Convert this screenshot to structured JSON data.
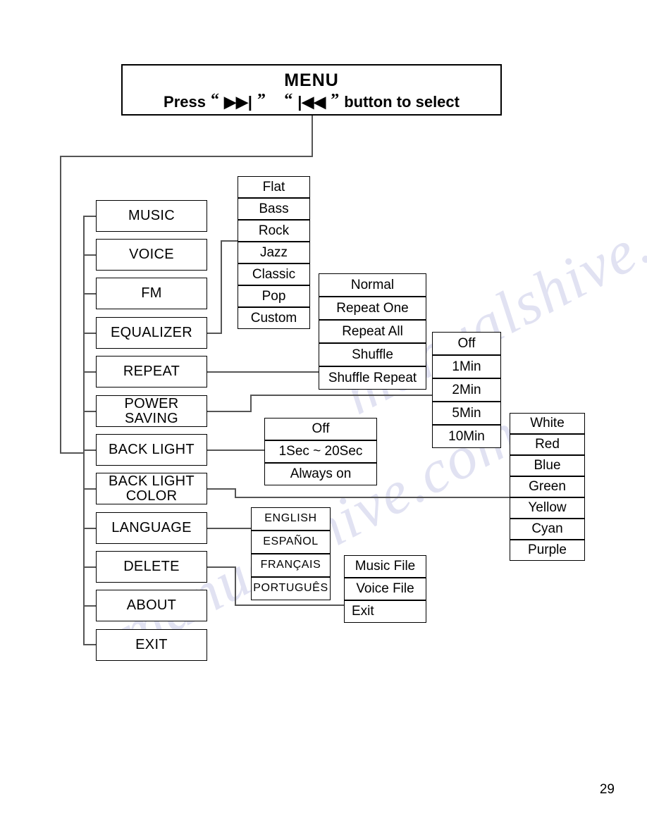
{
  "header": {
    "title": "MENU",
    "press_label": "Press",
    "quote_open": "“",
    "quote_close": "”",
    "next_icon": "next-track-icon",
    "prev_icon": "prev-track-icon",
    "next_glyph": "▶▶|",
    "prev_glyph": "|◀◀",
    "tail_label": "button to select"
  },
  "main_menu": [
    {
      "label": "MUSIC"
    },
    {
      "label": "VOICE"
    },
    {
      "label": "FM"
    },
    {
      "label": "EQUALIZER"
    },
    {
      "label": "REPEAT"
    },
    {
      "label": "POWER\nSAVING",
      "line1": "POWER",
      "line2": "SAVING"
    },
    {
      "label": "BACK LIGHT"
    },
    {
      "label": "BACK LIGHT\nCOLOR",
      "line1": "BACK LIGHT",
      "line2": "COLOR"
    },
    {
      "label": "LANGUAGE"
    },
    {
      "label": "DELETE"
    },
    {
      "label": "ABOUT"
    },
    {
      "label": "EXIT"
    }
  ],
  "equalizer_options": [
    "Flat",
    "Bass",
    "Rock",
    "Jazz",
    "Classic",
    "Pop",
    "Custom"
  ],
  "repeat_options": [
    "Normal",
    "Repeat One",
    "Repeat All",
    "Shuffle",
    "Shuffle Repeat"
  ],
  "power_saving_options": [
    "Off",
    "1Min",
    "2Min",
    "5Min",
    "10Min"
  ],
  "back_light_options": [
    "Off",
    "1Sec ~ 20Sec",
    "Always on"
  ],
  "back_light_color_options": [
    "White",
    "Red",
    "Blue",
    "Green",
    "Yellow",
    "Cyan",
    "Purple"
  ],
  "language_options": [
    "ENGLISH",
    "ESPAÑOL",
    "FRANÇAIS",
    "PORTUGUÊS"
  ],
  "delete_options": [
    "Music File",
    "Voice File",
    "Exit"
  ],
  "watermark": {
    "line1": "manualshive.com",
    "line2": "manualshive.com"
  },
  "page_number": "29"
}
